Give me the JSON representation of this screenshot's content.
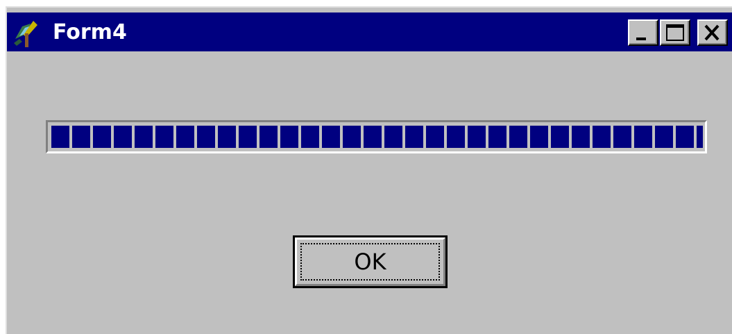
{
  "window": {
    "title": "Form4",
    "icon": "form-app-icon",
    "caption_buttons": [
      "minimize-icon",
      "maximize-icon",
      "close-icon"
    ]
  },
  "progress_bar": {
    "value_percent": 100,
    "fill_color": "#000080"
  },
  "ok_button": {
    "label": "OK",
    "focused": true
  },
  "colors": {
    "titlebar": "#000080",
    "face": "#c0c0c0"
  }
}
